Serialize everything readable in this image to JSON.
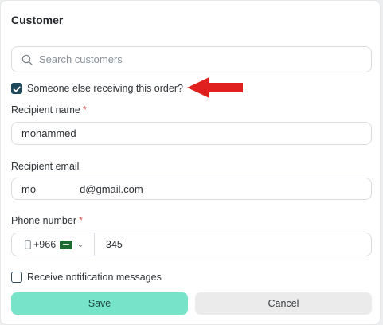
{
  "customer": {
    "title": "Customer",
    "search_placeholder": "Search customers",
    "someone_else_label": "Someone else receiving this order?",
    "someone_else_checked": true
  },
  "recipient": {
    "name_label": "Recipient name",
    "name_value": "mohammed",
    "email_label": "Recipient email",
    "email_prefix": "mo",
    "email_suffix": "d@gmail.com",
    "phone_label": "Phone number",
    "country_code": "+966",
    "phone_value": "345",
    "required_mark": "*"
  },
  "notifications": {
    "label": "Receive notification messages",
    "checked": false
  },
  "actions": {
    "save_label": "Save",
    "cancel_label": "Cancel"
  },
  "colors": {
    "accent": "#77e3c9",
    "checkbox": "#1f4a5c",
    "required": "#e24b4b",
    "annotation_arrow": "#e01f1f"
  }
}
